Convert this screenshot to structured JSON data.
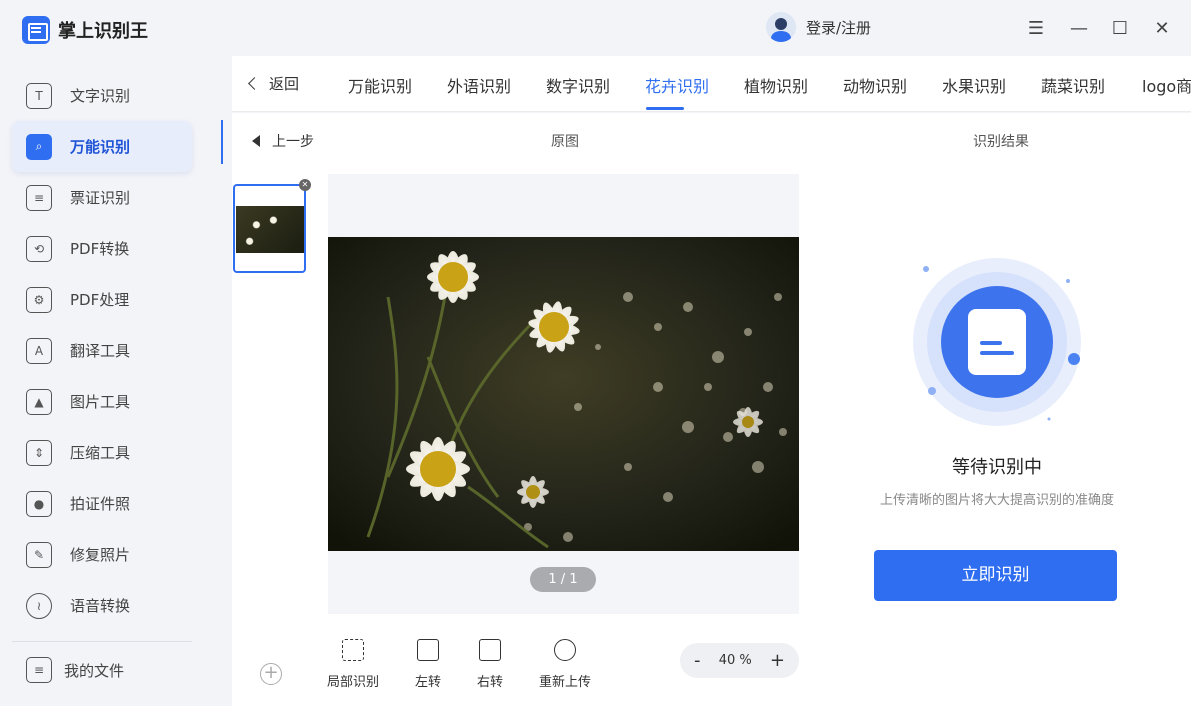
{
  "app": {
    "title": "掌上识别王"
  },
  "sidebar": {
    "items": [
      {
        "label": "文字识别",
        "icon": "text-recognition-icon"
      },
      {
        "label": "万能识别",
        "icon": "universal-recognition-icon",
        "active": true
      },
      {
        "label": "票证识别",
        "icon": "ticket-icon"
      },
      {
        "label": "PDF转换",
        "icon": "pdf-convert-icon"
      },
      {
        "label": "PDF处理",
        "icon": "pdf-process-icon"
      },
      {
        "label": "翻译工具",
        "icon": "translate-icon"
      },
      {
        "label": "图片工具",
        "icon": "image-tool-icon"
      },
      {
        "label": "压缩工具",
        "icon": "compress-icon"
      },
      {
        "label": "拍证件照",
        "icon": "id-photo-icon"
      },
      {
        "label": "修复照片",
        "icon": "repair-photo-icon"
      },
      {
        "label": "语音转换",
        "icon": "voice-icon"
      }
    ],
    "my_files": "我的文件"
  },
  "titlebar": {
    "login": "登录/注册",
    "menu": "☰",
    "minimize": "—",
    "maximize": "☐",
    "close": "✕"
  },
  "tabs": {
    "back": "返回",
    "items": [
      "万能识别",
      "外语识别",
      "数字识别",
      "花卉识别",
      "植物识别",
      "动物识别",
      "水果识别",
      "蔬菜识别",
      "logo商"
    ],
    "active": "花卉识别"
  },
  "editor": {
    "prev_step": "上一步",
    "original_label": "原图",
    "result_label": "识别结果",
    "pager": "1 / 1",
    "tools": [
      "局部识别",
      "左转",
      "右转",
      "重新上传"
    ],
    "zoom": {
      "minus": "-",
      "value": "40 %",
      "plus": "+"
    }
  },
  "result": {
    "title": "等待识别中",
    "subtitle": "上传清晰的图片将大大提高识别的准确度",
    "button": "立即识别"
  },
  "colors": {
    "accent": "#2f6ef0",
    "sidebar_bg": "#f3f4f8"
  }
}
